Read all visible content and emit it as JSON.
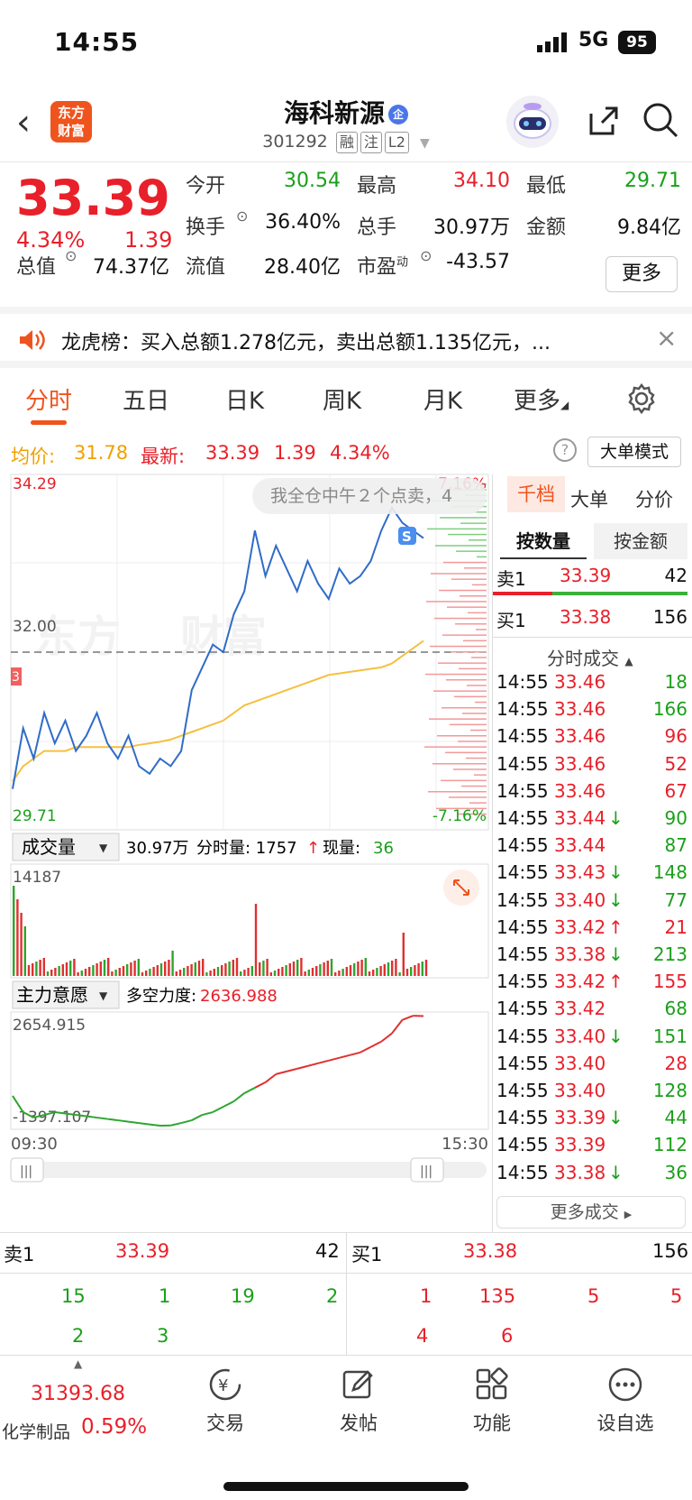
{
  "status_bar": {
    "time": "14:55",
    "network": "5G",
    "battery": "95"
  },
  "header": {
    "back_icon": "chevron-left-icon",
    "logo_line1": "东方",
    "logo_line2": "财富",
    "title": "海科新源",
    "enterprise_badge": "企",
    "code": "301292",
    "tags": [
      "融",
      "注",
      "L2"
    ]
  },
  "quote": {
    "price": "33.39",
    "change_pct": "4.34%",
    "change": "1.39",
    "open_label": "今开",
    "open": "30.54",
    "high_label": "最高",
    "high": "34.10",
    "low_label": "最低",
    "low": "29.71",
    "turnover_label": "换手",
    "turnover": "36.40%",
    "volume_label": "总手",
    "volume": "30.97万",
    "amount_label": "金额",
    "amount": "9.84亿",
    "mktcap_label": "总值",
    "mktcap": "74.37亿",
    "float_label": "流值",
    "float": "28.40亿",
    "pe_label": "市盈",
    "pe_sup": "动",
    "pe": "-43.57",
    "more": "更多"
  },
  "notice": {
    "text": "龙虎榜：买入总额1.278亿元，卖出总额1.135亿元，..."
  },
  "tabs": [
    "分时",
    "五日",
    "日K",
    "周K",
    "月K",
    "更多"
  ],
  "info_row": {
    "avg_label": "均价:",
    "avg": "31.78",
    "latest_label": "最新:",
    "latest": "33.39",
    "change": "1.39",
    "pct": "4.34%",
    "big_mode": "大单模式"
  },
  "chart_data": {
    "type": "line",
    "price": {
      "ylim": [
        29.71,
        34.29
      ],
      "y_max_label": "34.29",
      "y_min_label": "29.71",
      "pct_max": "7.16%",
      "pct_min": "-7.16%",
      "ref_label": "32.00",
      "ref_value": 32.0,
      "series": [
        {
          "name": "价格",
          "values": [
            30.2,
            31.0,
            30.6,
            31.2,
            30.8,
            31.1,
            30.7,
            30.9,
            31.2,
            30.8,
            30.6,
            30.9,
            30.5,
            30.4,
            30.6,
            30.5,
            30.7,
            31.5,
            31.8,
            32.1,
            32.0,
            32.5,
            32.8,
            33.6,
            33.0,
            33.4,
            33.1,
            32.8,
            33.2,
            32.9,
            32.7,
            33.1,
            32.9,
            33.0,
            33.2,
            33.6,
            33.9,
            33.7,
            33.6,
            33.5
          ]
        },
        {
          "name": "均价",
          "values": [
            30.3,
            30.5,
            30.6,
            30.7,
            30.7,
            30.7,
            30.75,
            30.75,
            30.75,
            30.75,
            30.75,
            30.75,
            30.78,
            30.8,
            30.82,
            30.85,
            30.9,
            30.95,
            31.0,
            31.05,
            31.1,
            31.2,
            31.3,
            31.35,
            31.4,
            31.45,
            31.5,
            31.55,
            31.6,
            31.65,
            31.7,
            31.72,
            31.74,
            31.76,
            31.78,
            31.8,
            31.85,
            31.95,
            32.05,
            32.15
          ]
        }
      ],
      "annotations": [
        "我全仓中午２个点卖，4",
        "S",
        "3"
      ]
    },
    "volume": {
      "label": "成交量",
      "total": "30.97万",
      "tick_label": "分时量: 1757",
      "now_label": "现量:",
      "now": "36",
      "y_max": "14187"
    },
    "main_force": {
      "label": "主力意愿",
      "strength_label": "多空力度:",
      "strength": "2636.988",
      "y_max": "2654.915",
      "y_min": "-1397.107",
      "values": [
        -300,
        -900,
        -1100,
        -1000,
        -900,
        -950,
        -1000,
        -1050,
        -1100,
        -1150,
        -1200,
        -1250,
        -1300,
        -1350,
        -1397,
        -1390,
        -1300,
        -1200,
        -1000,
        -900,
        -700,
        -500,
        -200,
        0,
        200,
        500,
        600,
        700,
        800,
        900,
        1000,
        1100,
        1200,
        1300,
        1500,
        1700,
        2000,
        2500,
        2650,
        2640
      ]
    },
    "time_start": "09:30",
    "time_end": "15:30"
  },
  "panel": {
    "tabs": [
      "千档",
      "大单",
      "分价"
    ],
    "sub_tabs": [
      "按数量",
      "按金额"
    ],
    "ask1": {
      "label": "卖1",
      "price": "33.39",
      "qty": "42"
    },
    "bid1": {
      "label": "买1",
      "price": "33.38",
      "qty": "156"
    },
    "ticks_header": "分时成交",
    "ticks": [
      {
        "time": "14:55",
        "price": "33.46",
        "arrow": "",
        "qty": "18",
        "color": "green"
      },
      {
        "time": "14:55",
        "price": "33.46",
        "arrow": "",
        "qty": "166",
        "color": "green"
      },
      {
        "time": "14:55",
        "price": "33.46",
        "arrow": "",
        "qty": "96",
        "color": "red"
      },
      {
        "time": "14:55",
        "price": "33.46",
        "arrow": "",
        "qty": "52",
        "color": "red"
      },
      {
        "time": "14:55",
        "price": "33.46",
        "arrow": "",
        "qty": "67",
        "color": "red"
      },
      {
        "time": "14:55",
        "price": "33.44",
        "arrow": "↓",
        "qty": "90",
        "color": "green"
      },
      {
        "time": "14:55",
        "price": "33.44",
        "arrow": "",
        "qty": "87",
        "color": "green"
      },
      {
        "time": "14:55",
        "price": "33.43",
        "arrow": "↓",
        "qty": "148",
        "color": "green"
      },
      {
        "time": "14:55",
        "price": "33.40",
        "arrow": "↓",
        "qty": "77",
        "color": "green"
      },
      {
        "time": "14:55",
        "price": "33.42",
        "arrow": "↑",
        "qty": "21",
        "color": "red"
      },
      {
        "time": "14:55",
        "price": "33.38",
        "arrow": "↓",
        "qty": "213",
        "color": "green"
      },
      {
        "time": "14:55",
        "price": "33.42",
        "arrow": "↑",
        "qty": "155",
        "color": "red"
      },
      {
        "time": "14:55",
        "price": "33.42",
        "arrow": "",
        "qty": "68",
        "color": "green"
      },
      {
        "time": "14:55",
        "price": "33.40",
        "arrow": "↓",
        "qty": "151",
        "color": "green"
      },
      {
        "time": "14:55",
        "price": "33.40",
        "arrow": "",
        "qty": "28",
        "color": "red"
      },
      {
        "time": "14:55",
        "price": "33.40",
        "arrow": "",
        "qty": "128",
        "color": "green"
      },
      {
        "time": "14:55",
        "price": "33.39",
        "arrow": "↓",
        "qty": "44",
        "color": "green"
      },
      {
        "time": "14:55",
        "price": "33.39",
        "arrow": "",
        "qty": "112",
        "color": "green"
      },
      {
        "time": "14:55",
        "price": "33.38",
        "arrow": "↓",
        "qty": "36",
        "color": "green"
      }
    ],
    "more_ticks": "更多成交"
  },
  "bottom_book": {
    "sell_label": "卖1",
    "sell_price": "33.39",
    "sell_qty": "42",
    "buy_label": "买1",
    "buy_price": "33.38",
    "buy_qty": "156",
    "sell_queue": [
      "15",
      "1",
      "19",
      "2",
      "2",
      "3"
    ],
    "buy_queue": [
      "1",
      "135",
      "5",
      "5",
      "4",
      "6"
    ]
  },
  "bottom_bar": {
    "index_value": "31393.68",
    "index_name": "化学制品",
    "index_pct": "0.59%",
    "buttons": [
      {
        "label": "交易",
        "icon": "trade-yen-icon"
      },
      {
        "label": "发帖",
        "icon": "edit-post-icon"
      },
      {
        "label": "功能",
        "icon": "grid-function-icon"
      },
      {
        "label": "设自选",
        "icon": "more-dots-icon"
      }
    ]
  },
  "colors": {
    "up": "#e8202a",
    "down": "#1aa01a",
    "accent": "#f0541e",
    "avg_line": "#f5c040",
    "price_line": "#2f6cc8"
  }
}
